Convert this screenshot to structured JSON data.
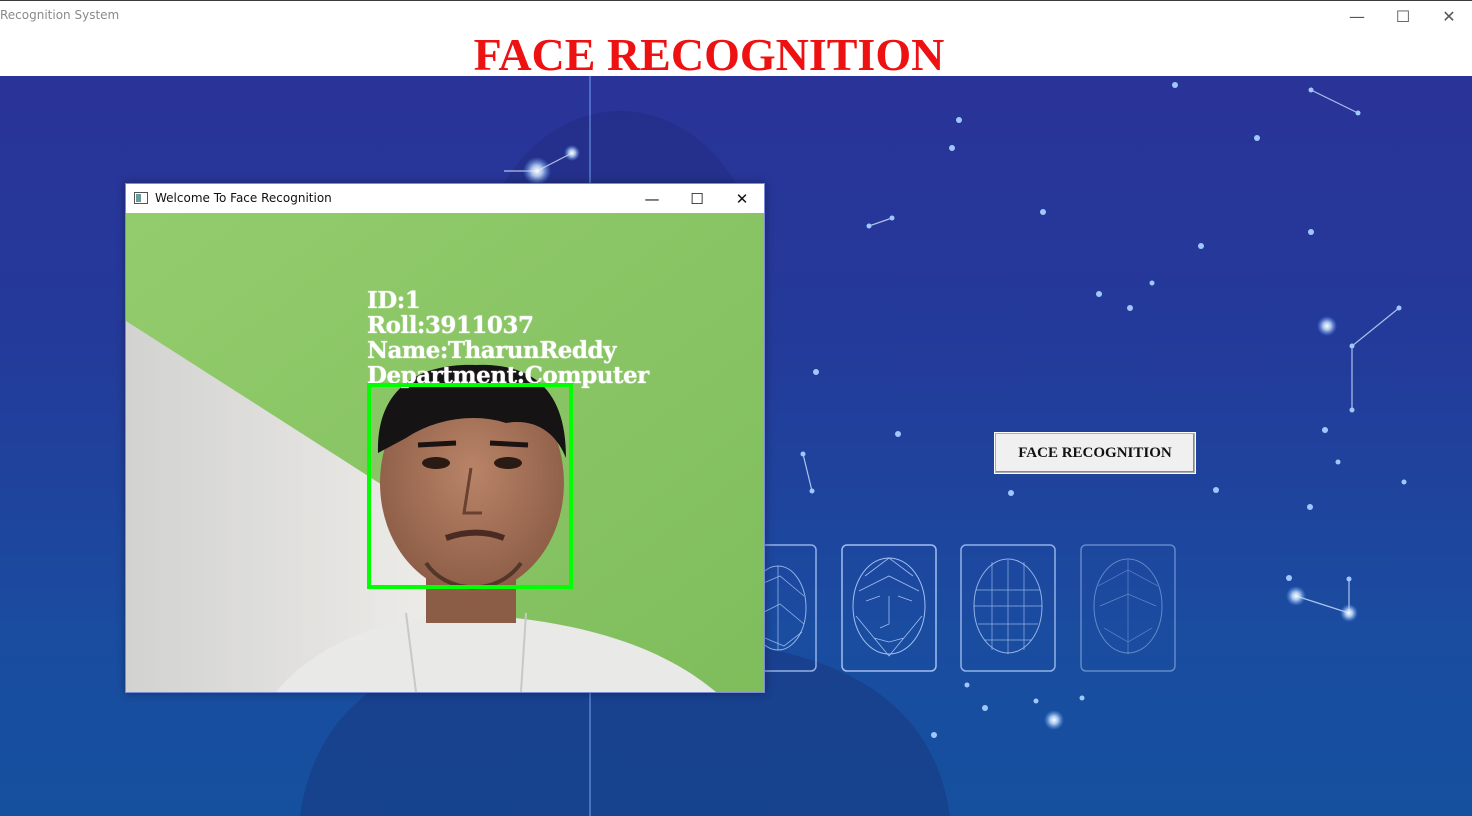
{
  "app": {
    "title": "Recognition System",
    "heading": "FACE RECOGNITION"
  },
  "window_controls": {
    "minimize": "—",
    "maximize": "☐",
    "close": "✕"
  },
  "main": {
    "face_recognition_button": "FACE RECOGNITION"
  },
  "camera_window": {
    "title": "Welcome To Face Recognition",
    "overlay": {
      "id": "ID:1",
      "roll": "Roll:3911037",
      "name": "Name:TharunReddy",
      "department": "Department:Computer"
    }
  },
  "colors": {
    "heading": "#ee1111",
    "background_top": "#2a3398",
    "background_bottom": "#15509e",
    "detection_box": "#00ff00",
    "camera_wall": "#8bc666"
  },
  "icons": [
    "window-app-icon",
    "minimize-icon",
    "maximize-icon",
    "close-icon",
    "face-mesh-icon"
  ]
}
